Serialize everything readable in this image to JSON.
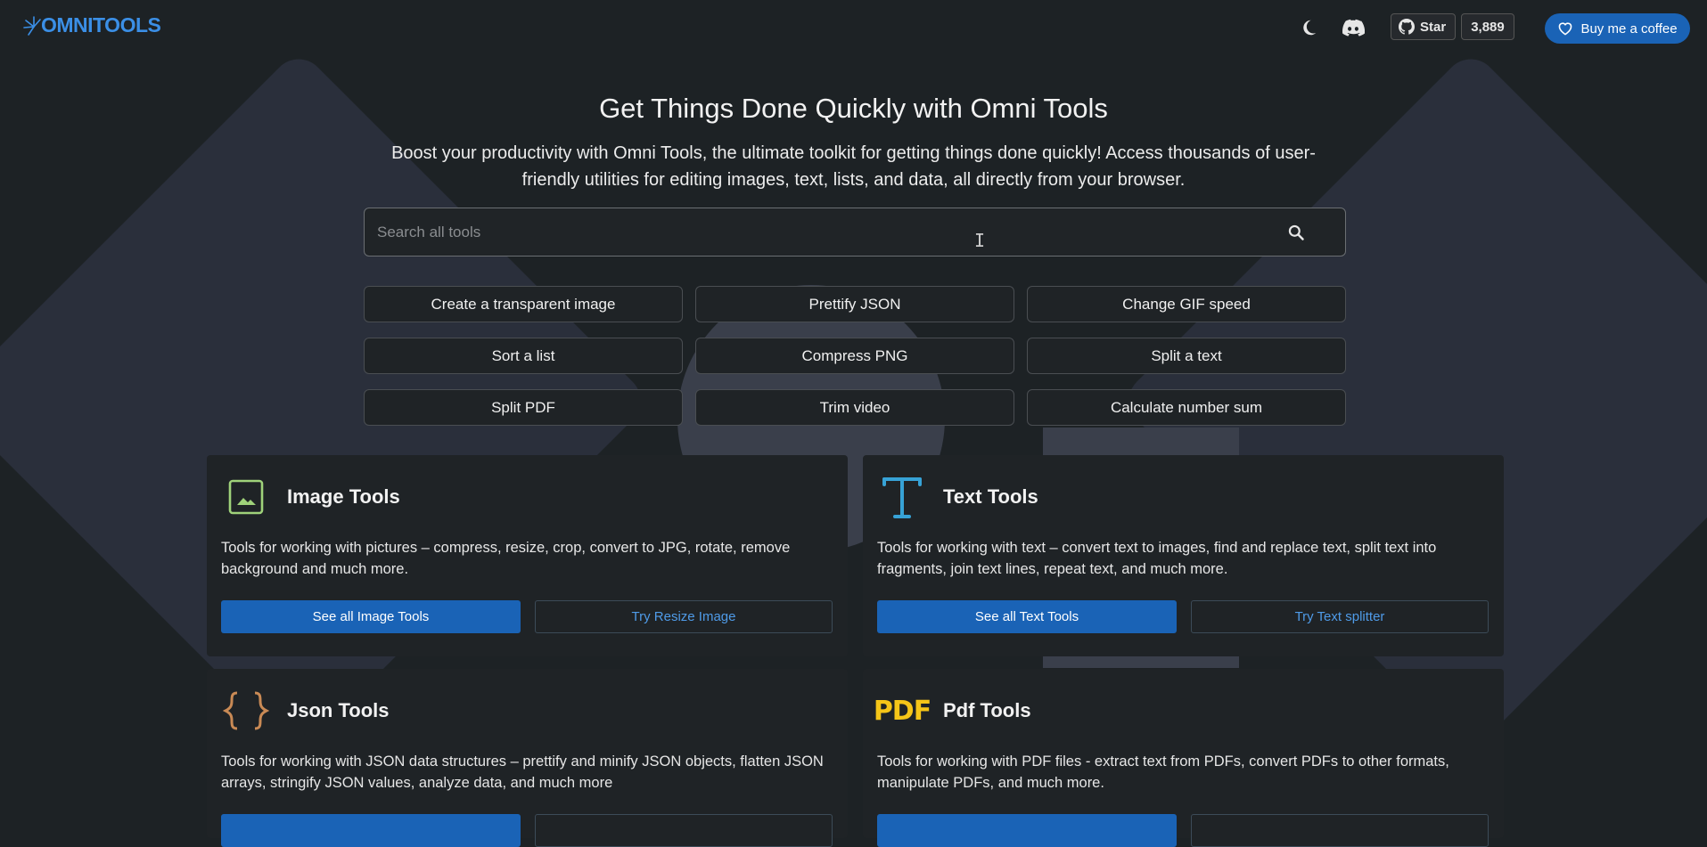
{
  "header": {
    "logo_text": "OMNITOOLS",
    "github_star_label": "Star",
    "github_star_count": "3,889",
    "coffee_label": "Buy me a coffee"
  },
  "hero": {
    "title": "Get Things Done Quickly with Omni Tools",
    "subtitle": "Boost your productivity with Omni Tools, the ultimate toolkit for getting things done quickly! Access thousands of user-friendly utilities for editing images, text, lists, and data, all directly from your browser."
  },
  "search": {
    "placeholder": "Search all tools",
    "value": ""
  },
  "quick_tools": [
    "Create a transparent image",
    "Prettify JSON",
    "Change GIF speed",
    "Sort a list",
    "Compress PNG",
    "Split a text",
    "Split PDF",
    "Trim video",
    "Calculate number sum"
  ],
  "cards": [
    {
      "title": "Image Tools",
      "icon": "image-icon",
      "description": "Tools for working with pictures – compress, resize, crop, convert to JPG, rotate, remove background and much more.",
      "primary": "See all Image Tools",
      "secondary": "Try Resize Image"
    },
    {
      "title": "Text Tools",
      "icon": "text-icon",
      "description": "Tools for working with text – convert text to images, find and replace text, split text into fragments, join text lines, repeat text, and much more.",
      "primary": "See all Text Tools",
      "secondary": "Try Text splitter"
    },
    {
      "title": "Json Tools",
      "icon": "json-icon",
      "description": "Tools for working with JSON data structures – prettify and minify JSON objects, flatten JSON arrays, stringify JSON values, analyze data, and much more",
      "primary": "",
      "secondary": ""
    },
    {
      "title": "Pdf Tools",
      "icon": "pdf-icon",
      "icon_text": "PDF",
      "description": "Tools for working with PDF files - extract text from PDFs, convert PDFs to other formats, manipulate PDFs, and much more.",
      "primary": "",
      "secondary": ""
    }
  ],
  "colors": {
    "accent": "#1a63b6",
    "logo": "#3b8fe6",
    "link": "#4f9be8",
    "pdf": "#f5c518",
    "json_icon": "#c98a55",
    "text_icon": "#37a2d6",
    "image_icon": "#9fd27a"
  }
}
